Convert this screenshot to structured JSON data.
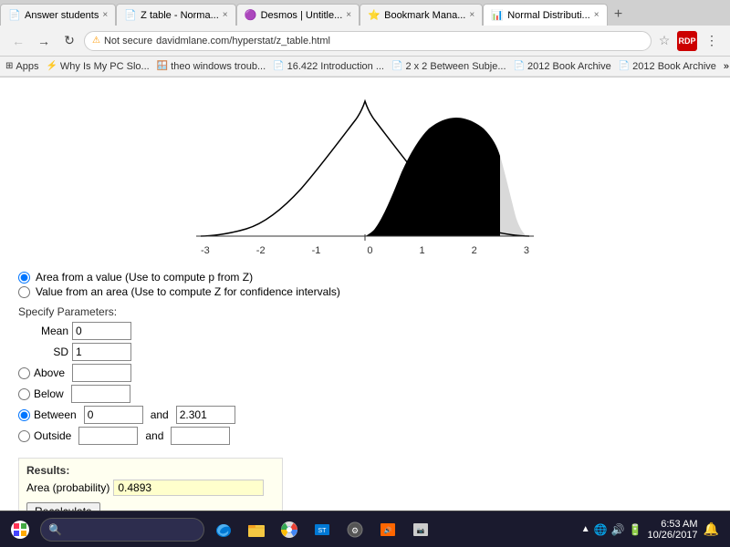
{
  "browser": {
    "tabs": [
      {
        "id": 1,
        "title": "Answer students",
        "active": false,
        "icon": "📄"
      },
      {
        "id": 2,
        "title": "Z table - Norma...",
        "active": false,
        "icon": "📄"
      },
      {
        "id": 3,
        "title": "Desmos | Untitle...",
        "active": false,
        "icon": "🟣"
      },
      {
        "id": 4,
        "title": "Bookmark Mana...",
        "active": false,
        "icon": "⭐"
      },
      {
        "id": 5,
        "title": "Normal Distributi...",
        "active": true,
        "icon": "📊"
      }
    ],
    "address": "davidmlane.com/hyperstat/z_table.html",
    "not_secure": "Not secure"
  },
  "bookmarks": [
    {
      "label": "Apps"
    },
    {
      "label": "Why Is My PC Slo..."
    },
    {
      "label": "theo windows troub..."
    },
    {
      "label": "16.422 Introduction ..."
    },
    {
      "label": "2 x 2 Between Subje..."
    },
    {
      "label": "2012 Book Archive"
    },
    {
      "label": "2012 Book Archive"
    }
  ],
  "page": {
    "options": [
      {
        "label": "Area from a value (Use to compute p from Z)",
        "selected": true
      },
      {
        "label": "Value from an area (Use to compute Z for confidence intervals)",
        "selected": false
      }
    ],
    "params_header": "Specify Parameters:",
    "mean_label": "Mean",
    "mean_value": "0",
    "sd_label": "SD",
    "sd_value": "1",
    "above_label": "Above",
    "above_value": "",
    "below_label": "Below",
    "below_value": "",
    "between_label": "Between",
    "between_value1": "0",
    "between_and": "and",
    "between_value2": "2.301",
    "outside_label": "Outside",
    "outside_value1": "",
    "outside_and": "and",
    "outside_value2": "",
    "results_label": "Results:",
    "area_prob_label": "Area (probability)",
    "area_prob_value": "0.4893",
    "recalculate_label": "Recalculate"
  },
  "graph": {
    "x_labels": [
      "-3",
      "-2",
      "-1",
      "0",
      "1",
      "2",
      "3"
    ],
    "shaded_from": 0,
    "shaded_to": 2.301
  },
  "taskbar": {
    "time": "6:53 AM",
    "date": "10/26/2017"
  }
}
